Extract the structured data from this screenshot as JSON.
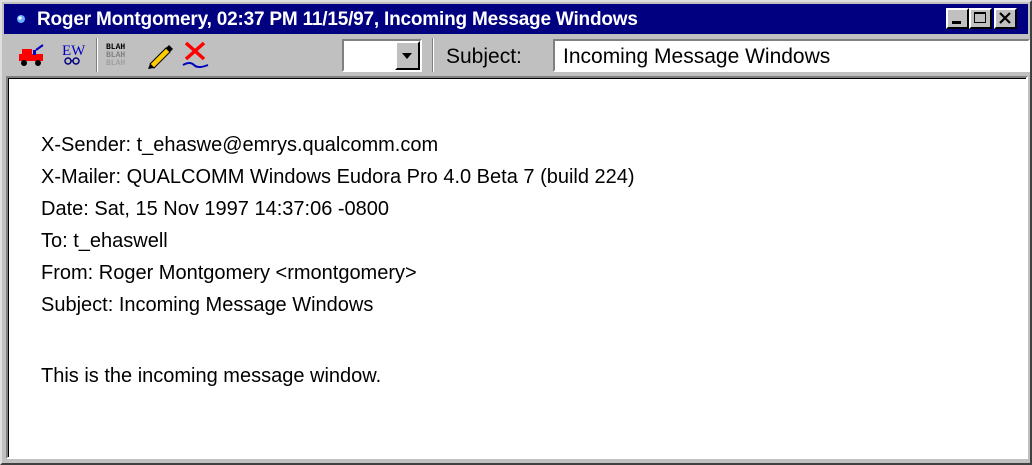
{
  "window": {
    "title": "Roger Montgomery, 02:37 PM 11/15/97, Incoming Message Windows",
    "title_icon": "message-icon"
  },
  "titlebar_buttons": [
    "minimize-icon",
    "maximize-icon",
    "close-icon"
  ],
  "toolbar": {
    "tools": [
      {
        "name": "priority-icon"
      },
      {
        "name": "text-icon"
      },
      {
        "name": "blah-icon",
        "glyph_text": "BLAH"
      },
      {
        "name": "pencil-icon"
      },
      {
        "name": "delete-icon"
      }
    ],
    "priority_combo_value": "",
    "subject_label": "Subject:",
    "subject_value": "Incoming Message Windows"
  },
  "message": {
    "headers": [
      "X-Sender: t_ehaswe@emrys.qualcomm.com",
      "X-Mailer: QUALCOMM Windows Eudora Pro 4.0 Beta 7 (build 224)",
      "Date: Sat, 15 Nov 1997 14:37:06 -0800",
      "To: t_ehaswell",
      "From: Roger Montgomery <rmontgomery>",
      "Subject: Incoming Message Windows"
    ],
    "body": "This is the incoming message window."
  },
  "colors": {
    "titlebar": "#000080",
    "face": "#c0c0c0",
    "delete_red": "#ff0000",
    "accent_blue": "#0000ff"
  }
}
